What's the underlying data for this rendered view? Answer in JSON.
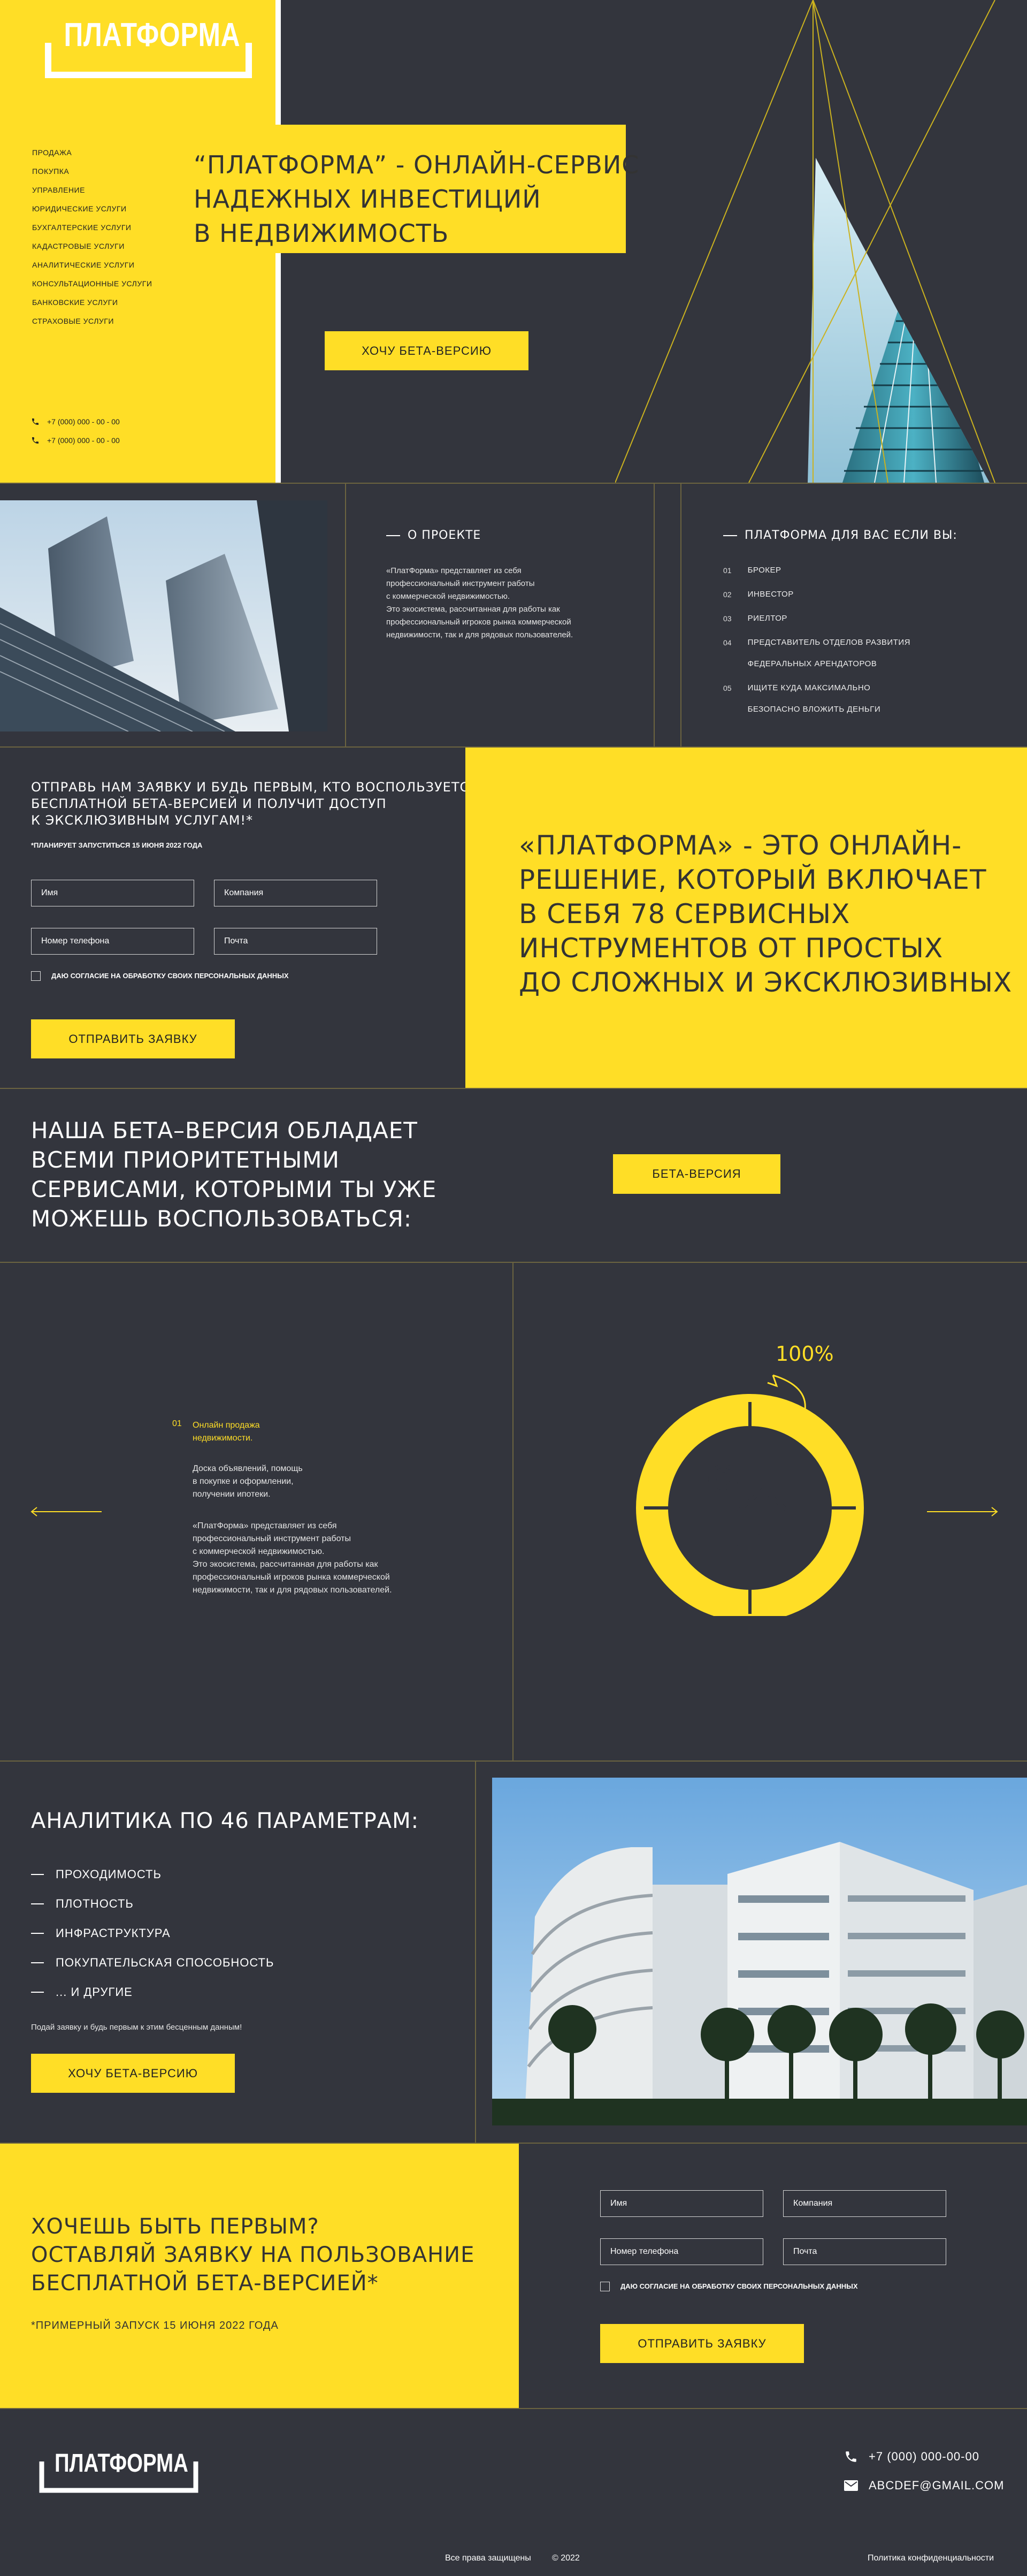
{
  "brand": {
    "logo": "ПЛАТФОРМА"
  },
  "nav": {
    "items": [
      "ПРОДАЖА",
      "ПОКУПКА",
      "УПРАВЛЕНИЕ",
      "ЮРИДИЧЕСКИЕ УСЛУГИ",
      "БУХГАЛТЕРСКИЕ УСЛУГИ",
      "КАДАСТРОВЫЕ УСЛУГИ",
      "АНАЛИТИЧЕСКИЕ УСЛУГИ",
      "КОНСУЛЬТАЦИОННЫЕ УСЛУГИ",
      "БАНКОВСКИЕ УСЛУГИ",
      "СТРАХОВЫЕ УСЛУГИ"
    ],
    "phones": [
      "+7 (000) 000 - 00 - 00",
      "+7 (000) 000 - 00 - 00"
    ]
  },
  "hero": {
    "title_lines": [
      "“ПЛАТФОРМА” - ОНЛАЙН-СЕРВИС",
      "НАДЕЖНЫХ ИНВЕСТИЦИЙ",
      "В НЕДВИЖИМОСТЬ"
    ],
    "cta": "ХОЧУ БЕТА-ВЕРСИЮ"
  },
  "about": {
    "heading": "О ПРОЕКТЕ",
    "text_lines": [
      "«ПлатФорма» представляет из себя",
      "профессиональный инструмент работы",
      "с коммерческой недвижимостью.",
      "Это экосистема, рассчитанная для работы как",
      "профессиональный игроков рынка коммерческой",
      "недвижимости, так и для рядовых пользователей."
    ]
  },
  "audience": {
    "heading": "ПЛАТФОРМА ДЛЯ ВАС ЕСЛИ  ВЫ:",
    "items": [
      {
        "num": "01",
        "lines": [
          "БРОКЕР"
        ]
      },
      {
        "num": "02",
        "lines": [
          "ИНВЕСТОР"
        ]
      },
      {
        "num": "03",
        "lines": [
          "РИЕЛТОР"
        ]
      },
      {
        "num": "04",
        "lines": [
          "ПРЕДСТАВИТЕЛЬ ОТДЕЛОВ РАЗВИТИЯ",
          "ФЕДЕРАЛЬНЫХ АРЕНДАТОРОВ"
        ]
      },
      {
        "num": "05",
        "lines": [
          "ИЩИТЕ КУДА МАКСИМАЛЬНО",
          "БЕЗОПАСНО ВЛОЖИТЬ ДЕНЬГИ"
        ]
      }
    ]
  },
  "form1": {
    "title_lines": [
      "ОТПРАВЬ НАМ ЗАЯВКУ И БУДЬ ПЕРВЫМ, КТО ВОСПОЛЬЗУЕТСЯ",
      "БЕСПЛАТНОЙ БЕТА-ВЕРСИЕЙ И ПОЛУЧИТ ДОСТУП",
      "К ЭКСКЛЮЗИВНЫМ УСЛУГАМ!*"
    ],
    "note": "*ПЛАНИРУЕТ ЗАПУСТИТЬСЯ 15 ИЮНЯ 2022 ГОДА",
    "name_placeholder": "Имя",
    "company_placeholder": "Компания",
    "phone_placeholder": "Номер телефона",
    "email_placeholder": "Почта",
    "consent": "ДАЮ СОГЛАСИЕ НА ОБРАБОТКУ СВОИХ ПЕРСОНАЛЬНЫХ ДАННЫХ",
    "submit": "ОТПРАВИТЬ ЗАЯВКУ"
  },
  "solution": {
    "lines": [
      "«ПЛАТФОРМА» - ЭТО ОНЛАЙН-",
      "РЕШЕНИЕ, КОТОРЫЙ ВКЛЮЧАЕТ",
      "В СЕБЯ 78 СЕРВИСНЫХ",
      "ИНСТРУМЕНТОВ ОТ ПРОСТЫХ",
      "ДО СЛОЖНЫХ И ЭКСКЛЮЗИВНЫХ"
    ]
  },
  "beta": {
    "lines": [
      "НАША БЕТА–ВЕРСИЯ ОБЛАДАЕТ",
      "ВСЕМИ ПРИОРИТЕТНЫМИ",
      "СЕРВИСАМИ, КОТОРЫМИ ТЫ УЖЕ",
      "МОЖЕШЬ ВОСПОЛЬЗОВАТЬСЯ:"
    ],
    "button": "БЕТА-ВЕРСИЯ"
  },
  "slider": {
    "num": "01",
    "title_lines": [
      "Онлайн продажа",
      "недвижимости."
    ],
    "desc_lines": [
      "Доска объявлений, помощь",
      "в покупке и оформлении,",
      "получении ипотеки."
    ],
    "text_lines": [
      "«ПлатФорма» представляет из себя",
      "профессиональный инструмент работы",
      "с коммерческой недвижимостью.",
      "Это экосистема, рассчитанная для работы как",
      "профессиональный игроков рынка коммерческой",
      "недвижимости, так и для рядовых пользователей."
    ],
    "percent": "100%",
    "progress": 1.0
  },
  "analytics": {
    "heading": "АНАЛИТИКА ПО 46 ПАРАМЕТРАМ:",
    "items": [
      "ПРОХОДИМОСТЬ",
      "ПЛОТНОСТЬ",
      "ИНФРАСТРУКТУРА",
      "ПОКУПАТЕЛЬСКАЯ СПОСОБНОСТЬ",
      "... И ДРУГИЕ"
    ],
    "note": "Подай заявку и будь первым к этим бесценным данным!",
    "cta": "ХОЧУ БЕТА-ВЕРСИЮ"
  },
  "form2": {
    "title_lines": [
      "ХОЧЕШЬ БЫТЬ ПЕРВЫМ?",
      "ОСТАВЛЯЙ ЗАЯВКУ НА ПОЛЬЗОВАНИЕ",
      "БЕСПЛАТНОЙ БЕТА-ВЕРСИЕЙ*"
    ],
    "note": "*ПРИМЕРНЫЙ ЗАПУСК 15 ИЮНЯ 2022 ГОДА",
    "name_placeholder": "Имя",
    "company_placeholder": "Компания",
    "phone_placeholder": "Номер телефона",
    "email_placeholder": "Почта",
    "consent": "ДАЮ СОГЛАСИЕ НА ОБРАБОТКУ СВОИХ ПЕРСОНАЛЬНЫХ ДАННЫХ",
    "submit": "ОТПРАВИТЬ ЗАЯВКУ"
  },
  "footer": {
    "logo": "ПЛАТФОРМА",
    "phone": "+7 (000) 000-00-00",
    "email": "ABCDEF@GMAIL.COM",
    "rights": "Все права защищены",
    "year": "© 2022",
    "privacy": "Политика конфиденциальности"
  },
  "colors": {
    "accent": "#ffde26",
    "background": "#33353d",
    "line": "#6c6440"
  }
}
